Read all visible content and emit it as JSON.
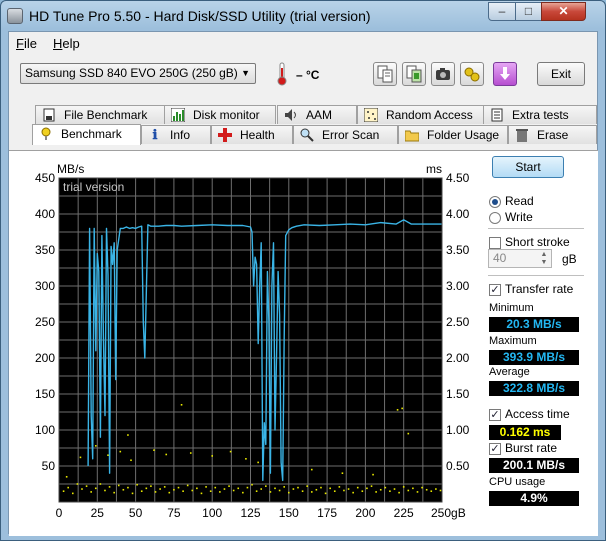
{
  "window": {
    "title": "HD Tune Pro 5.50 - Hard Disk/SSD Utility (trial version)",
    "buttons": {
      "minimize": "–",
      "maximize": "□",
      "close": "✕"
    }
  },
  "menu": {
    "items": [
      {
        "label": "File",
        "hotkey": "F",
        "rest": "ile"
      },
      {
        "label": "Help",
        "hotkey": "H",
        "rest": "elp"
      }
    ]
  },
  "toolbar": {
    "drive": "Samsung SSD 840 EVO 250G (250 gB)",
    "temperature": "– °C",
    "exit_label": "Exit",
    "icons": [
      "copy-text-icon",
      "copy-screenshot-icon",
      "camera-icon",
      "options-icon",
      "save-download-icon"
    ]
  },
  "tabs": {
    "top_row": [
      {
        "label": "File Benchmark",
        "icon": "file-benchmark-icon"
      },
      {
        "label": "Disk monitor",
        "icon": "disk-monitor-icon"
      },
      {
        "label": "AAM",
        "icon": "speaker-icon"
      },
      {
        "label": "Random Access",
        "icon": "random-access-icon"
      },
      {
        "label": "Extra tests",
        "icon": "extra-tests-icon"
      }
    ],
    "bottom_row": [
      {
        "label": "Benchmark",
        "icon": "benchmark-icon",
        "active": true
      },
      {
        "label": "Info",
        "icon": "info-icon"
      },
      {
        "label": "Health",
        "icon": "health-cross-icon"
      },
      {
        "label": "Error Scan",
        "icon": "magnifier-icon"
      },
      {
        "label": "Folder Usage",
        "icon": "folder-icon"
      },
      {
        "label": "Erase",
        "icon": "trash-icon"
      }
    ]
  },
  "chart_data": {
    "type": "line",
    "watermark": "trial version",
    "left_unit": "MB/s",
    "right_unit": "ms",
    "x_unit": "gB",
    "xlim": [
      0,
      250
    ],
    "ylim_left": [
      0,
      450
    ],
    "ylim_right": [
      0,
      4.5
    ],
    "x_ticks": [
      "0",
      "25",
      "50",
      "75",
      "100",
      "125",
      "150",
      "175",
      "200",
      "225",
      "250gB"
    ],
    "left_ticks": [
      "50",
      "100",
      "150",
      "200",
      "250",
      "300",
      "350",
      "400",
      "450"
    ],
    "right_ticks": [
      "0.50",
      "1.00",
      "1.50",
      "2.00",
      "2.50",
      "3.00",
      "3.50",
      "4.00",
      "4.50"
    ],
    "grid": true,
    "colors": {
      "background": "#000000",
      "grid": "#6e6e6e",
      "transfer": "#3ab4e6",
      "access": "#e8e800",
      "axis_text": "#000000"
    },
    "series": [
      {
        "name": "Transfer rate",
        "axis": "left",
        "x": [
          0,
          18,
          19,
          20,
          21,
          22,
          23,
          24,
          25,
          26,
          27,
          28,
          29,
          30,
          31,
          32,
          33,
          34,
          35,
          36,
          37,
          38,
          40,
          42,
          44,
          46,
          48,
          50,
          52,
          54,
          55,
          56,
          57,
          58,
          60,
          65,
          70,
          75,
          80,
          90,
          100,
          110,
          120,
          125,
          126,
          127,
          128,
          129,
          130,
          131,
          132,
          133,
          134,
          135,
          136,
          137,
          138,
          139,
          140,
          141,
          142,
          143,
          144,
          145,
          146,
          147,
          148,
          150,
          152,
          155,
          160,
          170,
          180,
          190,
          200,
          210,
          220,
          225,
          230,
          240,
          250
        ],
        "y": [
          null,
          null,
          50,
          380,
          120,
          60,
          380,
          210,
          345,
          320,
          90,
          370,
          230,
          120,
          380,
          315,
          40,
          355,
          330,
          360,
          170,
          350,
          380,
          380,
          382,
          380,
          381,
          380,
          382,
          383,
          250,
          200,
          290,
          385,
          383,
          383,
          384,
          384,
          383,
          384,
          385,
          384,
          384,
          382,
          375,
          300,
          340,
          330,
          220,
          300,
          360,
          30,
          110,
          80,
          320,
          250,
          40,
          300,
          360,
          100,
          200,
          320,
          260,
          55,
          30,
          230,
          370,
          378,
          381,
          383,
          385,
          384,
          385,
          386,
          385,
          388,
          386,
          392,
          386,
          386,
          386
        ]
      },
      {
        "name": "Access time",
        "axis": "right",
        "points": [
          [
            3,
            0.15
          ],
          [
            6,
            0.2
          ],
          [
            9,
            0.12
          ],
          [
            12,
            0.25
          ],
          [
            15,
            0.18
          ],
          [
            18,
            0.22
          ],
          [
            21,
            0.14
          ],
          [
            24,
            0.19
          ],
          [
            27,
            0.25
          ],
          [
            30,
            0.16
          ],
          [
            33,
            0.21
          ],
          [
            36,
            0.13
          ],
          [
            39,
            0.23
          ],
          [
            42,
            0.17
          ],
          [
            45,
            0.2
          ],
          [
            48,
            0.12
          ],
          [
            51,
            0.24
          ],
          [
            54,
            0.15
          ],
          [
            57,
            0.19
          ],
          [
            60,
            0.22
          ],
          [
            63,
            0.14
          ],
          [
            66,
            0.18
          ],
          [
            69,
            0.21
          ],
          [
            72,
            0.13
          ],
          [
            75,
            0.17
          ],
          [
            78,
            0.2
          ],
          [
            81,
            0.15
          ],
          [
            84,
            0.23
          ],
          [
            87,
            0.16
          ],
          [
            90,
            0.19
          ],
          [
            93,
            0.12
          ],
          [
            96,
            0.21
          ],
          [
            99,
            0.15
          ],
          [
            102,
            0.2
          ],
          [
            105,
            0.14
          ],
          [
            108,
            0.18
          ],
          [
            111,
            0.22
          ],
          [
            114,
            0.16
          ],
          [
            117,
            0.19
          ],
          [
            120,
            0.13
          ],
          [
            123,
            0.2
          ],
          [
            126,
            0.24
          ],
          [
            129,
            0.15
          ],
          [
            132,
            0.18
          ],
          [
            135,
            0.22
          ],
          [
            138,
            0.14
          ],
          [
            141,
            0.19
          ],
          [
            144,
            0.16
          ],
          [
            147,
            0.21
          ],
          [
            150,
            0.13
          ],
          [
            153,
            0.18
          ],
          [
            156,
            0.2
          ],
          [
            159,
            0.15
          ],
          [
            162,
            0.22
          ],
          [
            165,
            0.14
          ],
          [
            168,
            0.17
          ],
          [
            171,
            0.2
          ],
          [
            174,
            0.12
          ],
          [
            177,
            0.19
          ],
          [
            180,
            0.15
          ],
          [
            183,
            0.21
          ],
          [
            186,
            0.16
          ],
          [
            189,
            0.18
          ],
          [
            192,
            0.13
          ],
          [
            195,
            0.2
          ],
          [
            198,
            0.15
          ],
          [
            201,
            0.19
          ],
          [
            204,
            0.22
          ],
          [
            207,
            0.14
          ],
          [
            210,
            0.17
          ],
          [
            213,
            0.2
          ],
          [
            216,
            0.15
          ],
          [
            219,
            0.18
          ],
          [
            222,
            0.13
          ],
          [
            225,
            0.21
          ],
          [
            228,
            0.16
          ],
          [
            231,
            0.19
          ],
          [
            234,
            0.14
          ],
          [
            237,
            0.2
          ],
          [
            240,
            0.17
          ],
          [
            243,
            0.15
          ],
          [
            246,
            0.18
          ],
          [
            249,
            0.16
          ],
          [
            5,
            0.35
          ],
          [
            14,
            0.62
          ],
          [
            24,
            0.78
          ],
          [
            32,
            0.65
          ],
          [
            40,
            0.7
          ],
          [
            47,
            0.58
          ],
          [
            62,
            0.72
          ],
          [
            70,
            0.66
          ],
          [
            86,
            0.68
          ],
          [
            100,
            0.64
          ],
          [
            112,
            0.7
          ],
          [
            122,
            0.6
          ],
          [
            130,
            0.55
          ],
          [
            165,
            0.45
          ],
          [
            185,
            0.4
          ],
          [
            205,
            0.38
          ],
          [
            228,
            0.95
          ],
          [
            45,
            0.93
          ],
          [
            80,
            1.35
          ],
          [
            221,
            1.28
          ],
          [
            224,
            1.3
          ]
        ]
      }
    ]
  },
  "side": {
    "start_label": "Start",
    "read_label": "Read",
    "write_label": "Write",
    "mode": "read",
    "short_stroke_label": "Short stroke",
    "short_stroke_checked": false,
    "short_stroke_value": "40",
    "short_stroke_unit": "gB",
    "transfer_rate_label": "Transfer rate",
    "transfer_rate_checked": true,
    "minimum_label": "Minimum",
    "minimum_value": "20.3 MB/s",
    "maximum_label": "Maximum",
    "maximum_value": "393.9 MB/s",
    "average_label": "Average",
    "average_value": "322.8 MB/s",
    "access_time_label": "Access time",
    "access_time_checked": true,
    "access_time_value": "0.162 ms",
    "burst_rate_label": "Burst rate",
    "burst_rate_checked": true,
    "burst_rate_value": "200.1 MB/s",
    "cpu_usage_label": "CPU usage",
    "cpu_usage_value": "4.9%",
    "checkmark": "✓"
  }
}
